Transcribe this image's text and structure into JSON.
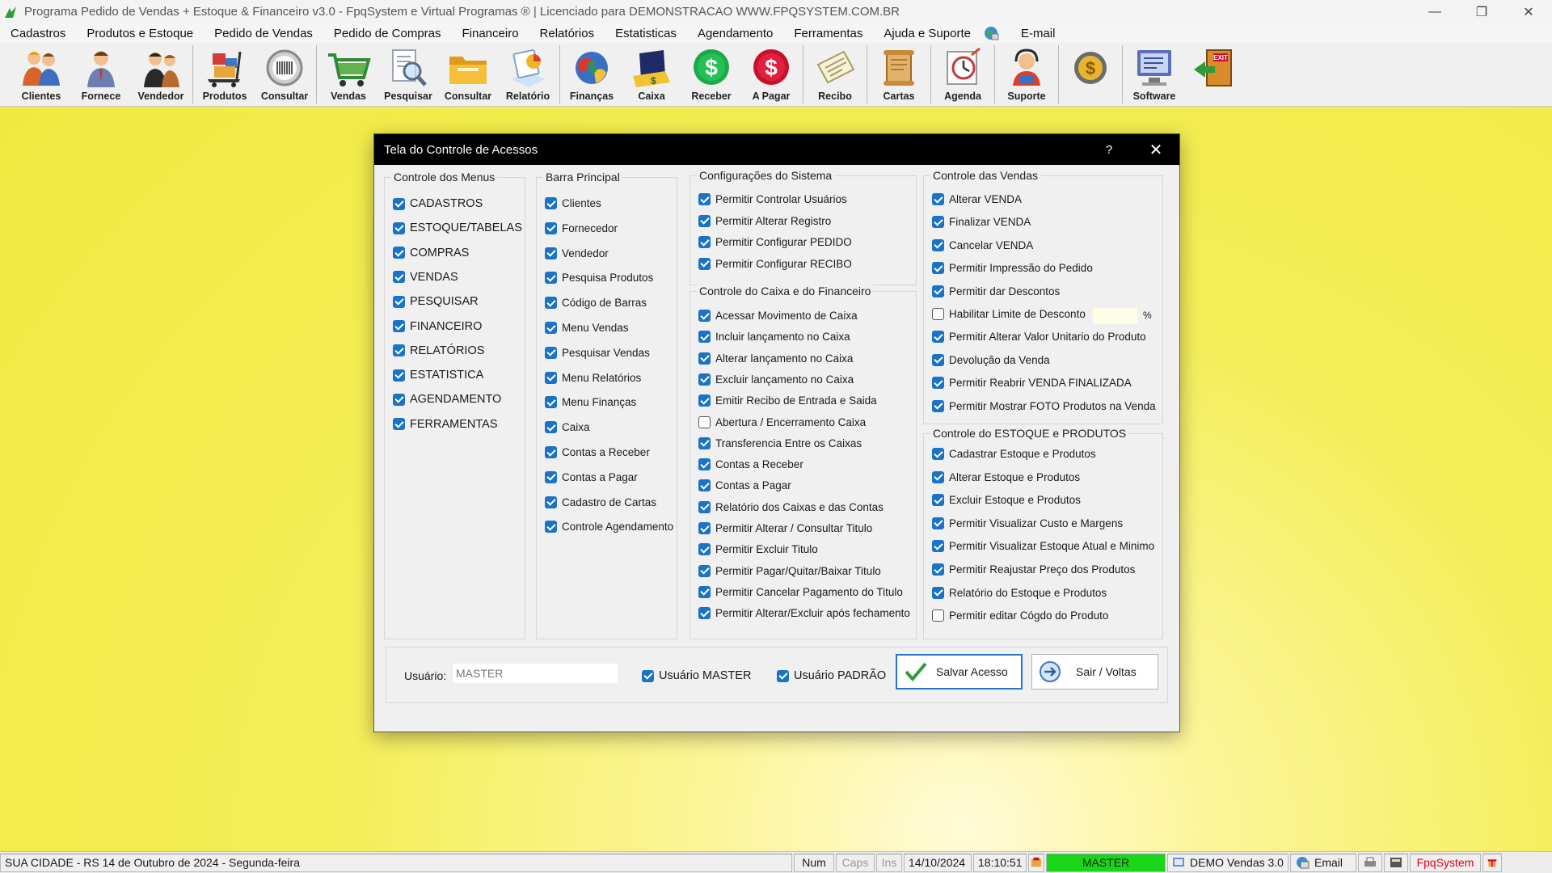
{
  "window": {
    "title": "Programa Pedido de Vendas + Estoque & Financeiro v3.0 - FpqSystem e Virtual Programas ® | Licenciado para  DEMONSTRACAO WWW.FPQSYSTEM.COM.BR",
    "minimize": "—",
    "maximize": "❐",
    "close": "✕"
  },
  "menu": [
    {
      "label": "Cadastros"
    },
    {
      "label": "Produtos e Estoque"
    },
    {
      "label": "Pedido de Vendas"
    },
    {
      "label": "Pedido de Compras"
    },
    {
      "label": "Financeiro"
    },
    {
      "label": "Relatórios"
    },
    {
      "label": "Estatisticas"
    },
    {
      "label": "Agendamento"
    },
    {
      "label": "Ferramentas"
    },
    {
      "label": "Ajuda e Suporte"
    },
    {
      "label": "E-mail"
    }
  ],
  "toolbar": [
    {
      "label": "Clientes",
      "icon": "clients-icon"
    },
    {
      "label": "Fornece",
      "icon": "supplier-icon"
    },
    {
      "label": "Vendedor",
      "icon": "seller-icon"
    },
    {
      "label": "Produtos",
      "icon": "products-icon"
    },
    {
      "label": "Consultar",
      "icon": "barcode-scan-icon"
    },
    {
      "label": "Vendas",
      "icon": "shopping-cart-icon"
    },
    {
      "label": "Pesquisar",
      "icon": "search-document-icon"
    },
    {
      "label": "Consultar",
      "icon": "folder-icon"
    },
    {
      "label": "Relatório",
      "icon": "report-icon"
    },
    {
      "label": "Finanças",
      "icon": "finance-globe-icon"
    },
    {
      "label": "Caixa",
      "icon": "cash-register-icon"
    },
    {
      "label": "Receber",
      "icon": "receive-dollar-icon"
    },
    {
      "label": "A Pagar",
      "icon": "pay-dollar-icon"
    },
    {
      "label": "Recibo",
      "icon": "receipt-icon"
    },
    {
      "label": "Cartas",
      "icon": "scroll-letter-icon"
    },
    {
      "label": "Agenda",
      "icon": "agenda-clock-icon"
    },
    {
      "label": "Suporte",
      "icon": "support-icon"
    },
    {
      "label": "",
      "icon": "coin-icon"
    },
    {
      "label": "Software",
      "icon": "software-monitor-icon"
    },
    {
      "label": "",
      "icon": "exit-door-icon"
    }
  ],
  "dialog": {
    "title": "Tela do Controle de Acessos",
    "help": "?",
    "close": "✕",
    "groups": {
      "menus": {
        "title": "Controle dos Menus",
        "items": [
          {
            "label": "CADASTROS",
            "checked": true
          },
          {
            "label": "ESTOQUE/TABELAS",
            "checked": true
          },
          {
            "label": "COMPRAS",
            "checked": true
          },
          {
            "label": "VENDAS",
            "checked": true
          },
          {
            "label": "PESQUISAR",
            "checked": true
          },
          {
            "label": "FINANCEIRO",
            "checked": true
          },
          {
            "label": "RELATÓRIOS",
            "checked": true
          },
          {
            "label": "ESTATISTICA",
            "checked": true
          },
          {
            "label": "AGENDAMENTO",
            "checked": true
          },
          {
            "label": "FERRAMENTAS",
            "checked": true
          }
        ]
      },
      "barra": {
        "title": "Barra Principal",
        "items": [
          {
            "label": "Clientes",
            "checked": true
          },
          {
            "label": "Fornecedor",
            "checked": true
          },
          {
            "label": "Vendedor",
            "checked": true
          },
          {
            "label": "Pesquisa Produtos",
            "checked": true
          },
          {
            "label": "Código de Barras",
            "checked": true
          },
          {
            "label": "Menu Vendas",
            "checked": true
          },
          {
            "label": "Pesquisar Vendas",
            "checked": true
          },
          {
            "label": "Menu Relatórios",
            "checked": true
          },
          {
            "label": "Menu Finanças",
            "checked": true
          },
          {
            "label": "Caixa",
            "checked": true
          },
          {
            "label": "Contas a Receber",
            "checked": true
          },
          {
            "label": "Contas a Pagar",
            "checked": true
          },
          {
            "label": "Cadastro de Cartas",
            "checked": true
          },
          {
            "label": "Controle Agendamento",
            "checked": true
          }
        ]
      },
      "config": {
        "title": "Configurações do Sistema",
        "items": [
          {
            "label": "Permitir Controlar Usuários",
            "checked": true
          },
          {
            "label": "Permitir Alterar Registro",
            "checked": true
          },
          {
            "label": "Permitir Configurar PEDIDO",
            "checked": true
          },
          {
            "label": "Permitir Configurar RECIBO",
            "checked": true
          }
        ]
      },
      "caixa": {
        "title": "Controle do Caixa e do Financeiro",
        "items": [
          {
            "label": "Acessar Movimento de Caixa",
            "checked": true
          },
          {
            "label": "Incluir lançamento no Caixa",
            "checked": true
          },
          {
            "label": "Alterar lançamento no Caixa",
            "checked": true
          },
          {
            "label": "Excluir lançamento no Caixa",
            "checked": true
          },
          {
            "label": "Emitir Recibo de Entrada e Saida",
            "checked": true
          },
          {
            "label": "Abertura / Encerramento Caixa",
            "checked": false
          },
          {
            "label": "Transferencia Entre os Caixas",
            "checked": true
          },
          {
            "label": "Contas a Receber",
            "checked": true
          },
          {
            "label": "Contas a Pagar",
            "checked": true
          },
          {
            "label": "Relatório dos Caixas e das Contas",
            "checked": true
          },
          {
            "label": "Permitir Alterar / Consultar Titulo",
            "checked": true
          },
          {
            "label": "Permitir Excluir Titulo",
            "checked": true
          },
          {
            "label": "Permitir Pagar/Quitar/Baixar Titulo",
            "checked": true
          },
          {
            "label": "Permitir Cancelar Pagamento do Titulo",
            "checked": true
          },
          {
            "label": "Permitir Alterar/Excluir após fechamento",
            "checked": true
          }
        ]
      },
      "vendas": {
        "title": "Controle das Vendas",
        "items": [
          {
            "label": "Alterar VENDA",
            "checked": true
          },
          {
            "label": "Finalizar VENDA",
            "checked": true
          },
          {
            "label": "Cancelar VENDA",
            "checked": true
          },
          {
            "label": "Permitir Impressão do Pedido",
            "checked": true
          },
          {
            "label": "Permitir dar Descontos",
            "checked": true
          },
          {
            "label": "Habilitar Limite de Desconto",
            "checked": false
          },
          {
            "label": "Permitir Alterar Valor Unitario do Produto",
            "checked": true
          },
          {
            "label": "Devolução da Venda",
            "checked": true
          },
          {
            "label": "Permitir Reabrir VENDA FINALIZADA",
            "checked": true
          },
          {
            "label": "Permitir Mostrar FOTO Produtos na Venda",
            "checked": true
          }
        ],
        "discount_value": "",
        "discount_unit": "%"
      },
      "estoque": {
        "title": "Controle do ESTOQUE e PRODUTOS",
        "items": [
          {
            "label": "Cadastrar Estoque e Produtos",
            "checked": true
          },
          {
            "label": "Alterar Estoque e Produtos",
            "checked": true
          },
          {
            "label": "Excluir Estoque e Produtos",
            "checked": true
          },
          {
            "label": "Permitir Visualizar Custo e Margens",
            "checked": true
          },
          {
            "label": "Permitir Visualizar Estoque Atual e Minimo",
            "checked": true
          },
          {
            "label": "Permitir Reajustar Preço dos Produtos",
            "checked": true
          },
          {
            "label": "Relatório do Estoque e Produtos",
            "checked": true
          },
          {
            "label": "Permitir editar Cógdo do Produto",
            "checked": false
          }
        ]
      }
    },
    "bottom": {
      "user_label": "Usuário:",
      "user_value": "MASTER",
      "master_label": "Usuário MASTER",
      "master_checked": true,
      "padrao_label": "Usuário PADRÃO",
      "padrao_checked": true,
      "save_label": "Salvar Acesso",
      "exit_label": "Sair / Voltas"
    }
  },
  "status": {
    "location": "SUA CIDADE - RS 14 de Outubro de 2024 - Segunda-feira",
    "num": "Num",
    "caps": "Caps",
    "ins": "Ins",
    "date": "14/10/2024",
    "time": "18:10:51",
    "user": "MASTER",
    "version": "DEMO Vendas 3.0",
    "email": "Email",
    "brand": "FpqSystem"
  },
  "colors": {
    "checkbox": "#1a73c7",
    "background": "#efe93c",
    "status_user": "#19d619",
    "brand": "#e2001a"
  }
}
